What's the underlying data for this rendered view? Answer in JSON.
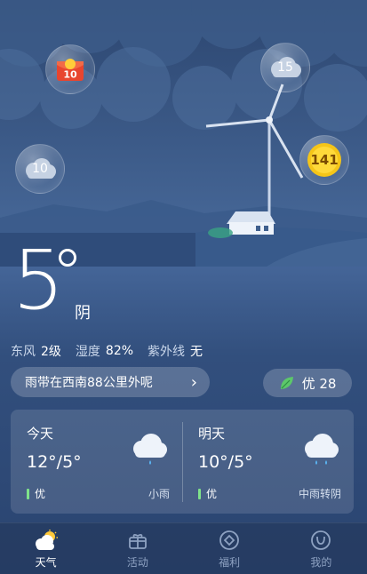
{
  "bubbles": {
    "red_envelope": "10",
    "top_right": "15",
    "left": "10",
    "coin": "141"
  },
  "current": {
    "temperature": "5",
    "condition": "阴",
    "stats": [
      {
        "label": "东风",
        "value": "2级"
      },
      {
        "label": "湿度",
        "value": "82%"
      },
      {
        "label": "紫外线",
        "value": "无"
      }
    ],
    "alert": "雨带在西南88公里外呢",
    "aqi": "优 28"
  },
  "forecast": {
    "today": {
      "label": "今天",
      "range": "12°/5°",
      "air": "优",
      "desc": "小雨"
    },
    "tomorrow": {
      "label": "明天",
      "range": "10°/5°",
      "air": "优",
      "desc": "中雨转阴"
    }
  },
  "nav": {
    "items": [
      {
        "label": "天气",
        "icon": "weather-icon"
      },
      {
        "label": "活动",
        "icon": "gift-icon"
      },
      {
        "label": "福利",
        "icon": "diamond-icon"
      },
      {
        "label": "我的",
        "icon": "profile-icon"
      }
    ]
  },
  "colors": {
    "accent_air": "#7fe38a",
    "coin": "#f5c518"
  }
}
